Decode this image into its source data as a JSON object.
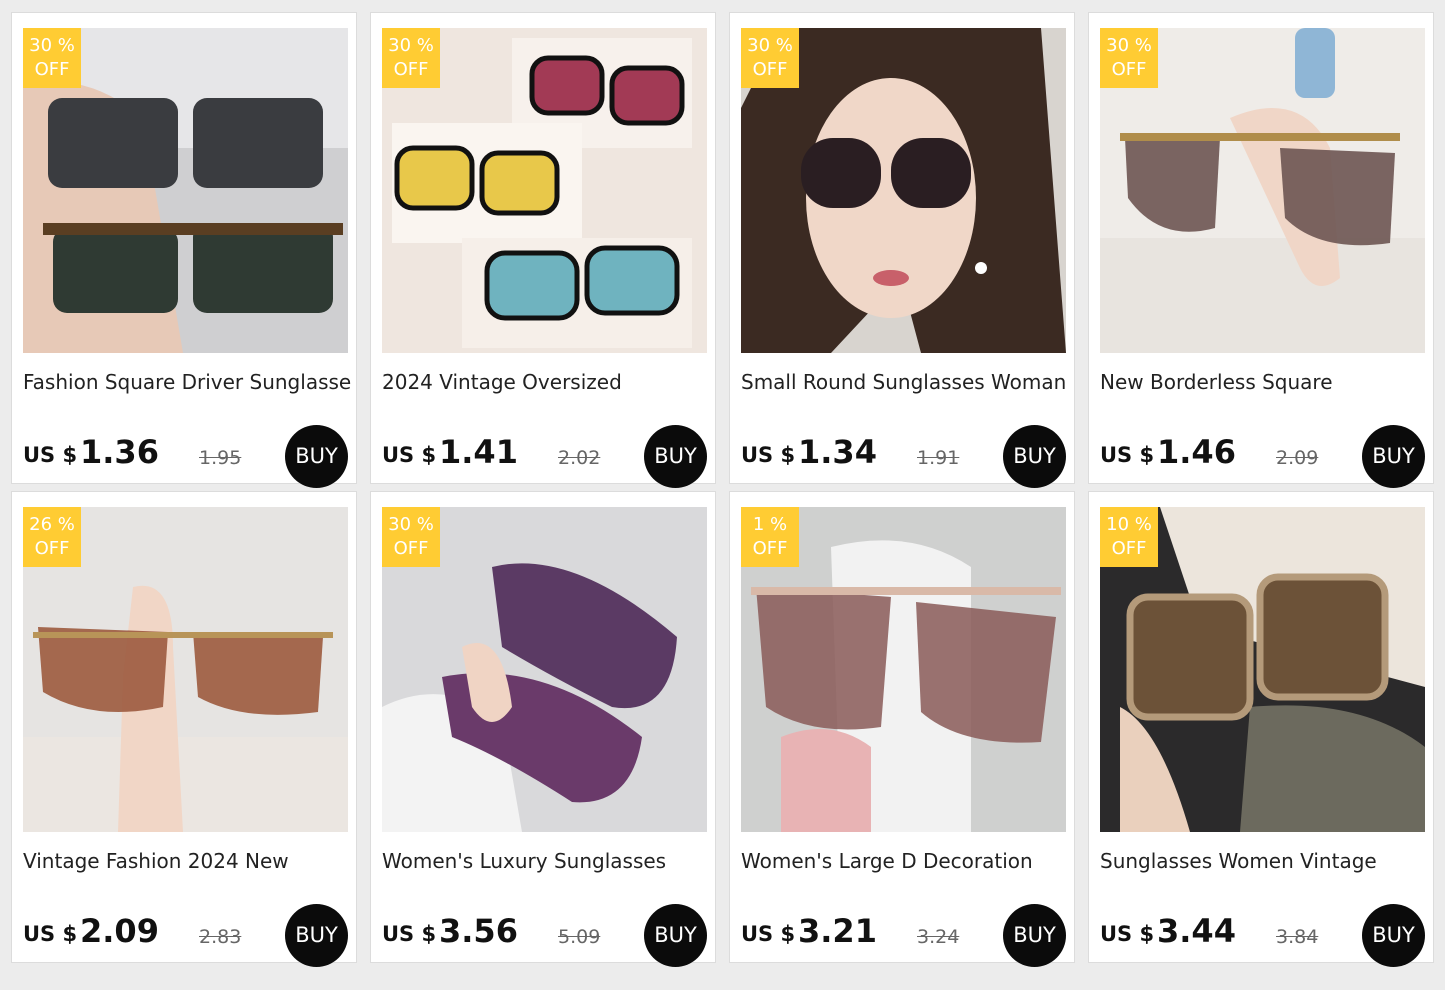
{
  "currency_label": "US $",
  "buy_label": "BUY",
  "badge_off_label": "OFF",
  "products": [
    {
      "discount": "30 %",
      "title": "Fashion Square Driver Sunglasses",
      "price": "1.36",
      "original_price": "1.95",
      "image": "sunglasses-square-photo"
    },
    {
      "discount": "30 %",
      "title": "2024 Vintage Oversized",
      "price": "1.41",
      "original_price": "2.02",
      "image": "sunglasses-tinted-aviator-photo"
    },
    {
      "discount": "30 %",
      "title": "Small Round Sunglasses Woman",
      "price": "1.34",
      "original_price": "1.91",
      "image": "woman-wearing-sunglasses-photo"
    },
    {
      "discount": "30 %",
      "title": "New Borderless Square",
      "price": "1.46",
      "original_price": "2.09",
      "image": "rimless-sunglasses-photo"
    },
    {
      "discount": "26 %",
      "title": "Vintage Fashion 2024 New",
      "price": "2.09",
      "original_price": "2.83",
      "image": "brown-rimless-sunglasses-photo"
    },
    {
      "discount": "30 %",
      "title": "Women's Luxury Sunglasses",
      "price": "3.56",
      "original_price": "5.09",
      "image": "shield-sunglasses-photo"
    },
    {
      "discount": "1 %",
      "title": "Women's Large D Decoration",
      "price": "3.21",
      "original_price": "3.24",
      "image": "large-pink-sunglasses-photo"
    },
    {
      "discount": "10 %",
      "title": "Sunglasses Women Vintage",
      "price": "3.44",
      "original_price": "3.84",
      "image": "square-brown-sunglasses-photo"
    }
  ]
}
